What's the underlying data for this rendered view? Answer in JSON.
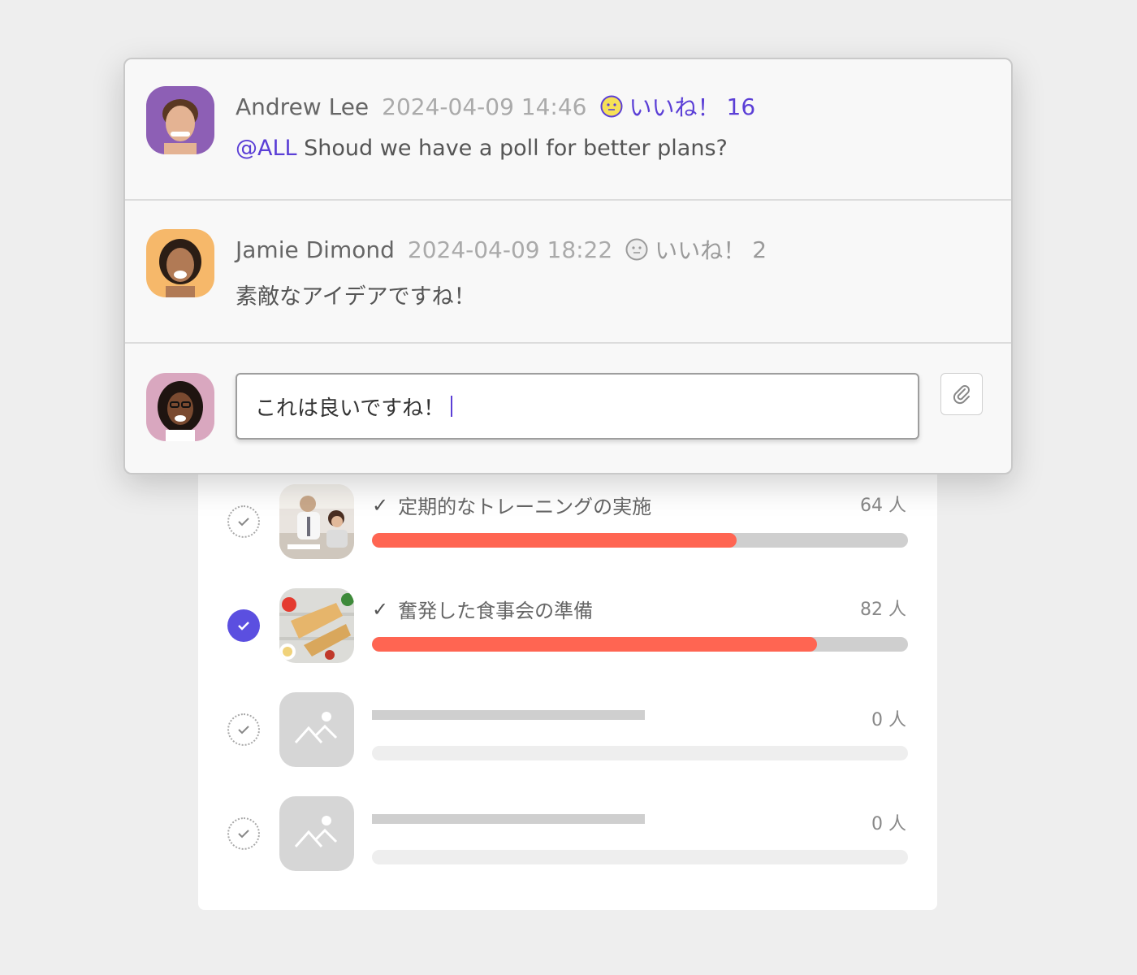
{
  "comments": [
    {
      "author": "Andrew Lee",
      "timestamp": "2024-04-09 14:46",
      "like_label": "いいね！",
      "like_count": "16",
      "liked": true,
      "mention": "@ALL",
      "text": "Shoud we have a poll for better plans?"
    },
    {
      "author": "Jamie Dimond",
      "timestamp": "2024-04-09 18:22",
      "like_label": "いいね！",
      "like_count": "2",
      "liked": false,
      "mention": "",
      "text": "素敵なアイデアですね！"
    }
  ],
  "reply": {
    "value": "これは良いですね！"
  },
  "poll": {
    "options": [
      {
        "label": "定期的なトレーニングの実施",
        "count": "64 人",
        "fraction": 0.68,
        "selected": false,
        "image": "training-photo"
      },
      {
        "label": "奮発した食事会の準備",
        "count": "82 人",
        "fraction": 0.83,
        "selected": true,
        "image": "food-photo"
      },
      {
        "label": "",
        "count": "0 人",
        "fraction": 0,
        "selected": false,
        "image": "image-placeholder-icon"
      },
      {
        "label": "",
        "count": "0 人",
        "fraction": 0,
        "selected": false,
        "image": "image-placeholder-icon"
      }
    ]
  },
  "colors": {
    "accent": "#5b3fd6",
    "bar_fill": "#ff6552",
    "bar_track": "#cfcfcf"
  }
}
